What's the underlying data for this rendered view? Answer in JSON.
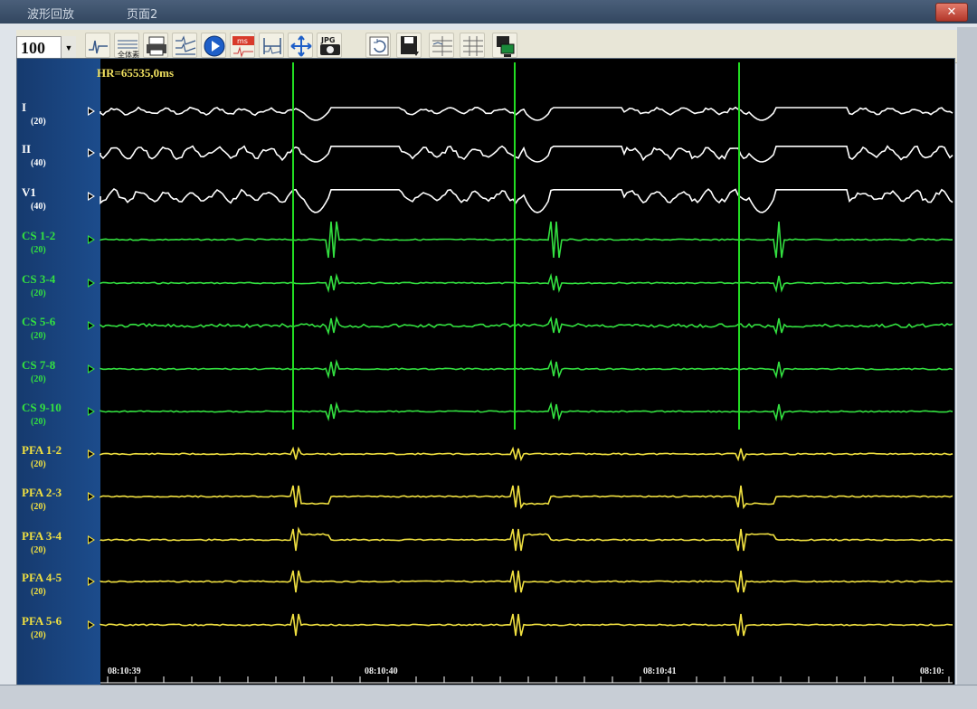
{
  "window": {
    "tabs": [
      {
        "label": "波形回放"
      },
      {
        "label": "页面2"
      }
    ],
    "close_icon": "close-icon"
  },
  "toolbar": {
    "zoom_value": "100",
    "buttons": [
      {
        "name": "waveform-icon"
      },
      {
        "name": "full-chart-icon",
        "text": "全体素"
      },
      {
        "name": "print-icon"
      },
      {
        "name": "channels-icon"
      },
      {
        "name": "play-icon"
      },
      {
        "name": "ms-measure-icon",
        "text": "ms"
      },
      {
        "name": "caliper-icon"
      },
      {
        "name": "move-arrows-icon"
      },
      {
        "name": "jpg-camera-icon",
        "text": "JPG"
      },
      {
        "name": "refresh-icon"
      },
      {
        "name": "save-icon"
      },
      {
        "name": "grid-layout-icon"
      },
      {
        "name": "grid-layout-2-icon"
      },
      {
        "name": "monitor-icon"
      }
    ]
  },
  "readout": {
    "hr": "HR=65535,0ms"
  },
  "colors": {
    "surface": "#ffffff",
    "cs": "#33e040",
    "pfa": "#f0e040",
    "pacing_line": "#22dd22"
  },
  "channels": [
    {
      "label": "I",
      "gain": "(20)",
      "color": "#ffffff"
    },
    {
      "label": "II",
      "gain": "(40)",
      "color": "#ffffff"
    },
    {
      "label": "V1",
      "gain": "(40)",
      "color": "#ffffff"
    },
    {
      "label": "CS 1-2",
      "gain": "(20)",
      "color": "#33e040"
    },
    {
      "label": "CS 3-4",
      "gain": "(20)",
      "color": "#33e040"
    },
    {
      "label": "CS 5-6",
      "gain": "(20)",
      "color": "#33e040"
    },
    {
      "label": "CS 7-8",
      "gain": "(20)",
      "color": "#33e040"
    },
    {
      "label": "CS 9-10",
      "gain": "(20)",
      "color": "#33e040"
    },
    {
      "label": "PFA 1-2",
      "gain": "(20)",
      "color": "#f0e040"
    },
    {
      "label": "PFA 2-3",
      "gain": "(20)",
      "color": "#f0e040"
    },
    {
      "label": "PFA 3-4",
      "gain": "(20)",
      "color": "#f0e040"
    },
    {
      "label": "PFA 4-5",
      "gain": "(20)",
      "color": "#f0e040"
    },
    {
      "label": "PFA 5-6",
      "gain": "(20)",
      "color": "#f0e040"
    }
  ],
  "time_axis": {
    "labels": [
      "08:10:39",
      "08:10:40",
      "08:10:41",
      "08:10:"
    ]
  }
}
